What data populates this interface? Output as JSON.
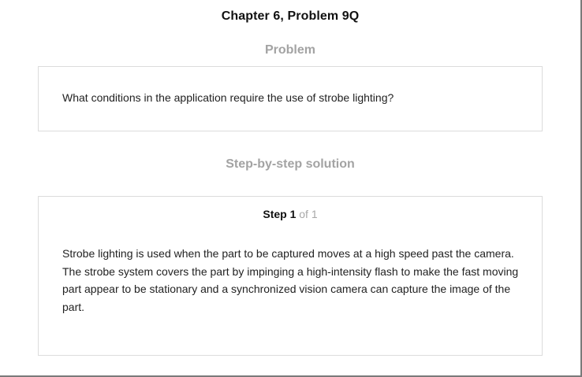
{
  "header": {
    "title": "Chapter 6, Problem 9Q"
  },
  "problem": {
    "heading": "Problem",
    "text": "What conditions in the application require the use of strobe lighting?"
  },
  "solution": {
    "heading": "Step-by-step solution",
    "step": {
      "label": "Step 1",
      "of": "of 1",
      "text": "Strobe lighting is used when the part to be captured moves at a high speed past the camera. The strobe system covers the part by impinging a high-intensity flash to make the fast moving part appear to be stationary and a synchronized vision camera can capture the image of the part."
    }
  }
}
